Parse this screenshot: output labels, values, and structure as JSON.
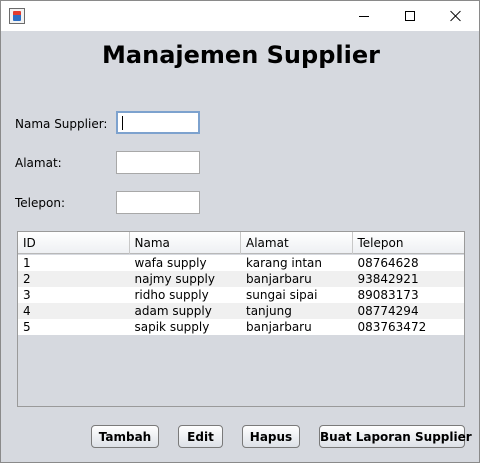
{
  "window": {
    "icon": "java-cup-icon",
    "controls": {
      "minimize": "minimize-icon",
      "maximize": "maximize-icon",
      "close": "close-icon"
    }
  },
  "title": "Manajemen Supplier",
  "form": {
    "nama_label": "Nama Supplier:",
    "nama_value": "",
    "alamat_label": "Alamat:",
    "alamat_value": "",
    "telepon_label": "Telepon:",
    "telepon_value": ""
  },
  "table": {
    "columns": [
      "ID",
      "Nama",
      "Alamat",
      "Telepon"
    ],
    "rows": [
      [
        "1",
        "wafa supply",
        "karang intan",
        "08764628"
      ],
      [
        "2",
        "najmy supply",
        "banjarbaru",
        "93842921"
      ],
      [
        "3",
        "ridho supply",
        "sungai sipai",
        "89083173"
      ],
      [
        "4",
        "adam supply",
        "tanjung",
        "08774294"
      ],
      [
        "5",
        "sapik supply",
        "banjarbaru",
        "083763472"
      ]
    ]
  },
  "buttons": {
    "tambah": "Tambah",
    "edit": "Edit",
    "hapus": "Hapus",
    "laporan": "Buat Laporan Supplier"
  },
  "colors": {
    "background": "#d6d9df",
    "focus_border": "#7da2ce",
    "row_alt": "#f0f0f0"
  }
}
